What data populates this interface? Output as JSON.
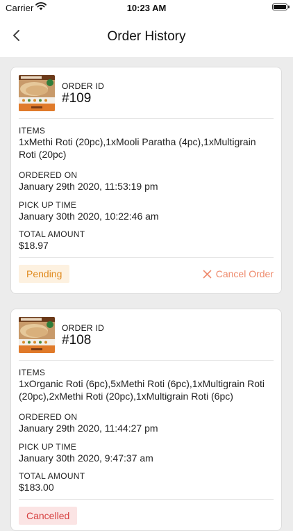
{
  "status_bar": {
    "carrier": "Carrier",
    "time": "10:23 AM"
  },
  "header": {
    "title": "Order History",
    "back_icon": "chevron-left-icon"
  },
  "colors": {
    "pending_text": "#e08a1e",
    "pending_bg": "#fdf1e0",
    "cancelled_text": "#d64040",
    "cancelled_bg": "#fbe4e4",
    "cancel_action": "#ee8a6c"
  },
  "orders": [
    {
      "id_label": "ORDER ID",
      "id": "#109",
      "items_label": "ITEMS",
      "items": "1xMethi Roti (20pc),1xMooli Paratha (4pc),1xMultigrain Roti (20pc)",
      "ordered_on_label": "ORDERED ON",
      "ordered_on": "January 29th 2020, 11:53:19 pm",
      "pickup_label": "PICK UP TIME",
      "pickup": "January 30th 2020, 10:22:46 am",
      "total_label": "TOTAL AMOUNT",
      "total": "$18.97",
      "status": "Pending",
      "action": "Cancel Order"
    },
    {
      "id_label": "ORDER ID",
      "id": "#108",
      "items_label": "ITEMS",
      "items": "1xOrganic Roti (6pc),5xMethi Roti (6pc),1xMultigrain Roti (20pc),2xMethi Roti (20pc),1xMultigrain Roti (6pc)",
      "ordered_on_label": "ORDERED ON",
      "ordered_on": "January 29th 2020, 11:44:27 pm",
      "pickup_label": "PICK UP TIME",
      "pickup": "January 30th 2020, 9:47:37 am",
      "total_label": "TOTAL AMOUNT",
      "total": "$183.00",
      "status": "Cancelled"
    }
  ]
}
